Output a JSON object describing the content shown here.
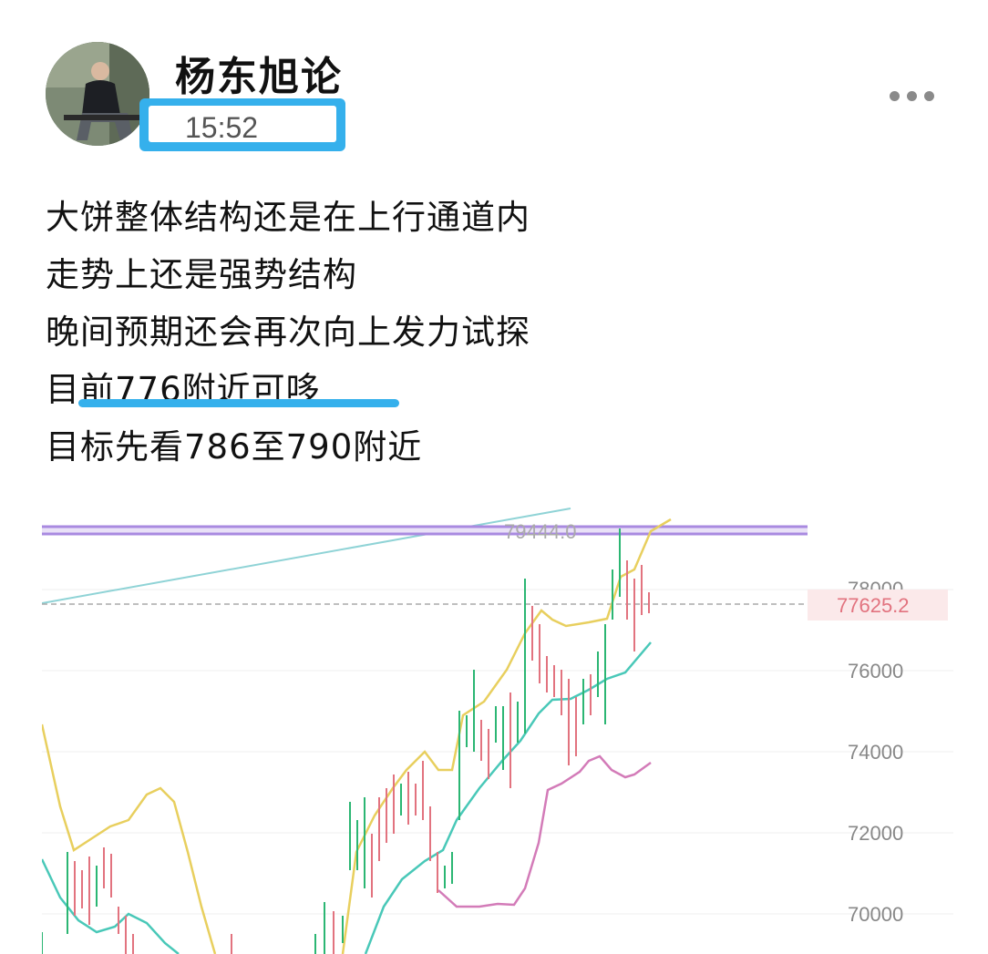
{
  "post": {
    "author": "杨东旭论",
    "time": "15:52",
    "lines": [
      "大饼整体结构还是在上行通道内",
      "走势上还是强势结构",
      "晚间预期还会再次向上发力试探",
      "目前776附近可哆",
      "目标先看786至790附近"
    ]
  },
  "icons": {
    "more": "more-dots-icon",
    "avatar": "user-avatar"
  },
  "colors": {
    "highlight": "#35b0ec",
    "resistance": "#a98ae0",
    "up_candle": "#2bb673",
    "down_candle": "#e2737f",
    "band_upper": "#e8cf5e",
    "band_mid": "#49c8b8",
    "band_lower": "#d37bb8",
    "channel": "#8fd3d6"
  },
  "chart_data": {
    "type": "candlestick",
    "y_ticks": [
      "78000",
      "76000",
      "74000",
      "72000",
      "70000"
    ],
    "resistance_label": "79444.0",
    "current_price_label": "77625.2",
    "ylim": [
      69000,
      80500
    ]
  }
}
